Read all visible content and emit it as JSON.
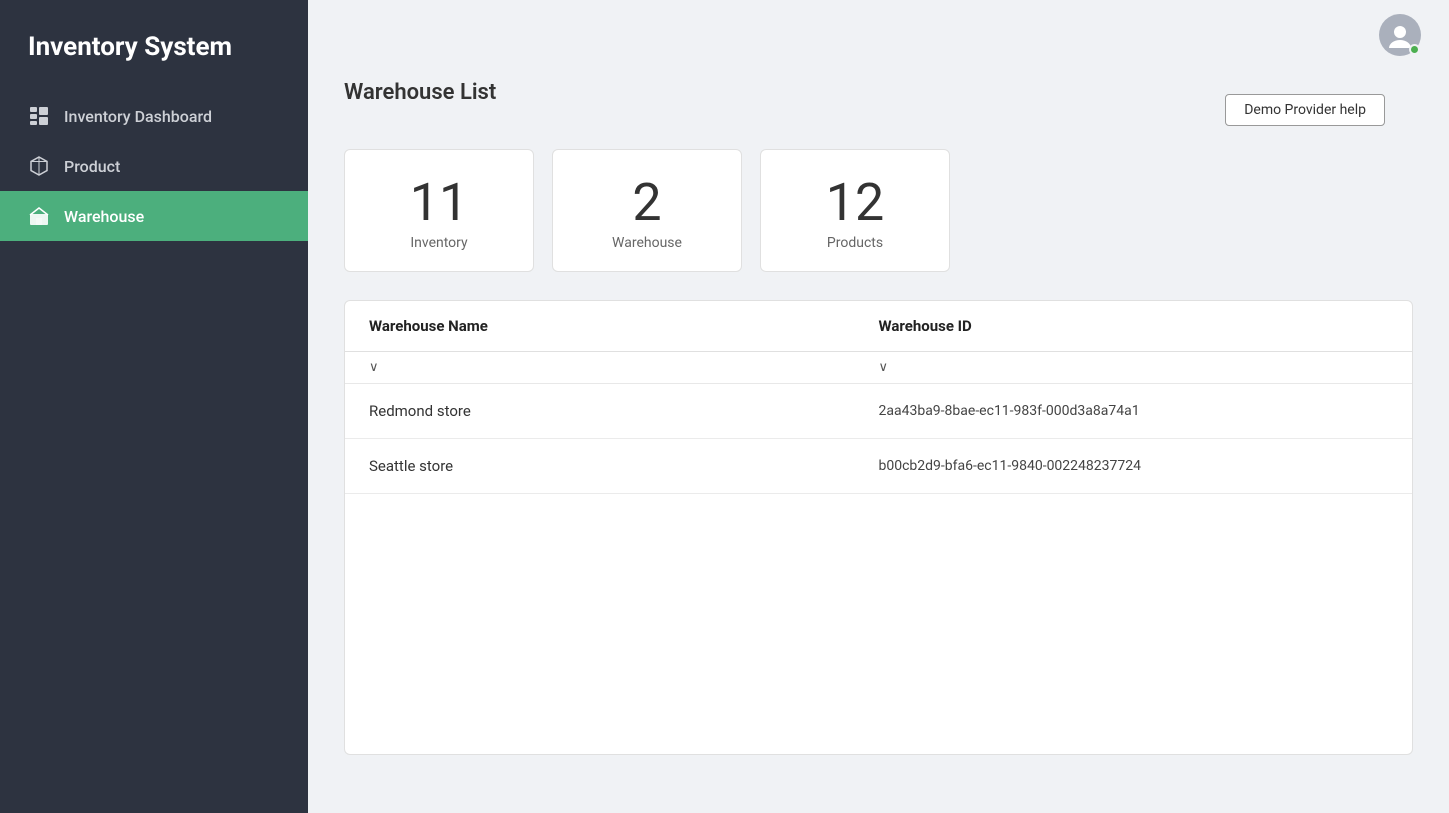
{
  "app": {
    "title": "Inventory System"
  },
  "sidebar": {
    "items": [
      {
        "id": "inventory-dashboard",
        "label": "Inventory Dashboard",
        "active": false
      },
      {
        "id": "product",
        "label": "Product",
        "active": false
      },
      {
        "id": "warehouse",
        "label": "Warehouse",
        "active": true
      }
    ]
  },
  "header": {
    "help_button": "Demo Provider help"
  },
  "page": {
    "title": "Warehouse List"
  },
  "stats": [
    {
      "number": "11",
      "label": "Inventory"
    },
    {
      "number": "2",
      "label": "Warehouse"
    },
    {
      "number": "12",
      "label": "Products"
    }
  ],
  "table": {
    "columns": [
      {
        "id": "name",
        "label": "Warehouse Name"
      },
      {
        "id": "id",
        "label": "Warehouse ID"
      }
    ],
    "rows": [
      {
        "name": "Redmond store",
        "warehouse_id": "2aa43ba9-8bae-ec11-983f-000d3a8a74a1"
      },
      {
        "name": "Seattle store",
        "warehouse_id": "b00cb2d9-bfa6-ec11-9840-002248237724"
      }
    ]
  },
  "icons": {
    "dashboard": "▦",
    "product": "⬡",
    "warehouse": "⊞",
    "chevron_down": "∨"
  }
}
